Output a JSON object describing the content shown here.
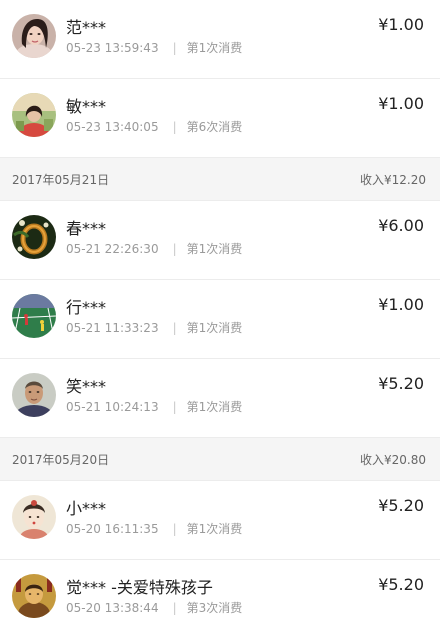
{
  "sections": [
    {
      "date": "",
      "income": "",
      "items": [
        {
          "name": "范***",
          "time": "05-23 13:59:43",
          "count": "第1次消费",
          "amount": "¥1.00",
          "avatar": "avatar-woman-portrait"
        },
        {
          "name": "敏***",
          "time": "05-23 13:40:05",
          "count": "第6次消费",
          "amount": "¥1.00",
          "avatar": "avatar-woman-photo"
        }
      ]
    },
    {
      "date": "2017年05月21日",
      "income": "收入¥12.20",
      "items": [
        {
          "name": "春***",
          "time": "05-21 22:26:30",
          "count": "第1次消费",
          "amount": "¥6.00",
          "avatar": "avatar-jade-bracelet"
        },
        {
          "name": "行***",
          "time": "05-21 11:33:23",
          "count": "第1次消费",
          "amount": "¥1.00",
          "avatar": "avatar-badminton-court"
        },
        {
          "name": "笑***",
          "time": "05-21 10:24:13",
          "count": "第1次消费",
          "amount": "¥5.20",
          "avatar": "avatar-man-portrait"
        }
      ]
    },
    {
      "date": "2017年05月20日",
      "income": "收入¥20.80",
      "items": [
        {
          "name": "小***",
          "time": "05-20 16:11:35",
          "count": "第1次消费",
          "amount": "¥5.20",
          "avatar": "avatar-cartoon-girl"
        },
        {
          "name": "觉*** -关爱特殊孩子",
          "time": "05-20 13:38:44",
          "count": "第3次消费",
          "amount": "¥5.20",
          "avatar": "avatar-buddha-figure"
        }
      ]
    }
  ]
}
